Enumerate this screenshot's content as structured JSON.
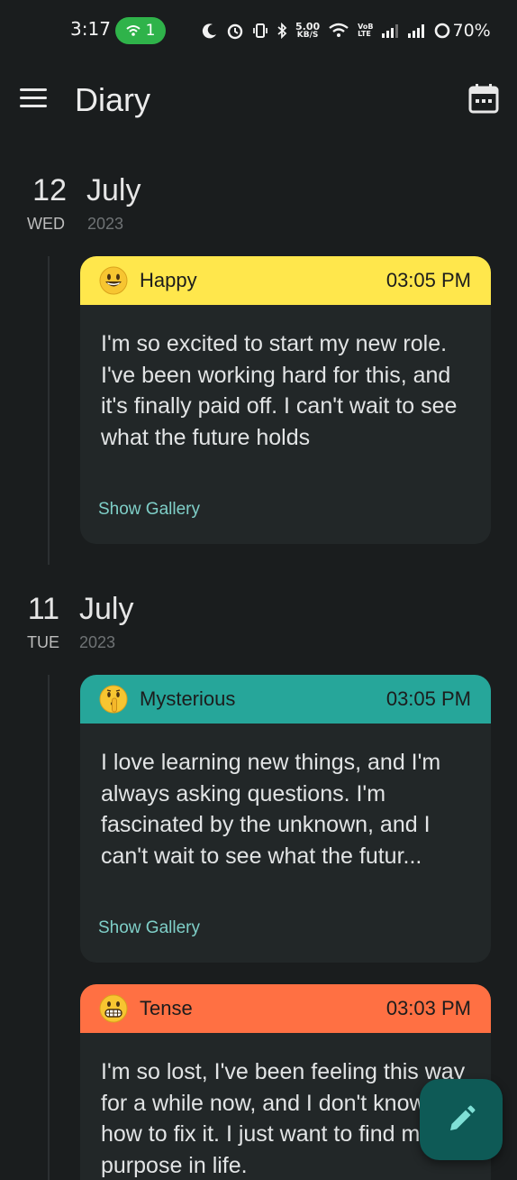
{
  "status_bar": {
    "time": "3:17",
    "hotspot_count": "1",
    "net_speed_top": "5.00",
    "net_speed_bottom": "KB/S",
    "lte_top": "VoB",
    "lte_bottom": "LTE",
    "battery": "70%"
  },
  "app_bar": {
    "title": "Diary",
    "menu_icon": "menu-icon",
    "calendar_icon": "calendar-icon"
  },
  "days": [
    {
      "day": "12",
      "weekday": "WED",
      "month": "July",
      "year": "2023",
      "entries": [
        {
          "mood": "Happy",
          "emoji": "grinning-face-icon",
          "time": "03:05 PM",
          "color": "#ffe74c",
          "text": "I'm so excited to start my new role. I've been working hard for this, and it's finally paid off. I can't wait to see what the future holds",
          "gallery_label": "Show Gallery"
        }
      ]
    },
    {
      "day": "11",
      "weekday": "TUE",
      "month": "July",
      "year": "2023",
      "entries": [
        {
          "mood": "Mysterious",
          "emoji": "shushing-face-icon",
          "time": "03:05 PM",
          "color": "#26a69a",
          "text": "I love learning new things, and I'm always asking questions. I'm fascinated by the unknown, and I can't wait to see what the futur...",
          "gallery_label": "Show Gallery"
        },
        {
          "mood": "Tense",
          "emoji": "grimacing-face-icon",
          "time": "03:03 PM",
          "color": "#ff7043",
          "text": "I'm so lost, I've been feeling this way for a while now, and I don't know how to fix it. I just want to find my purpose in life."
        }
      ]
    }
  ],
  "fab": {
    "icon": "pencil-icon"
  }
}
